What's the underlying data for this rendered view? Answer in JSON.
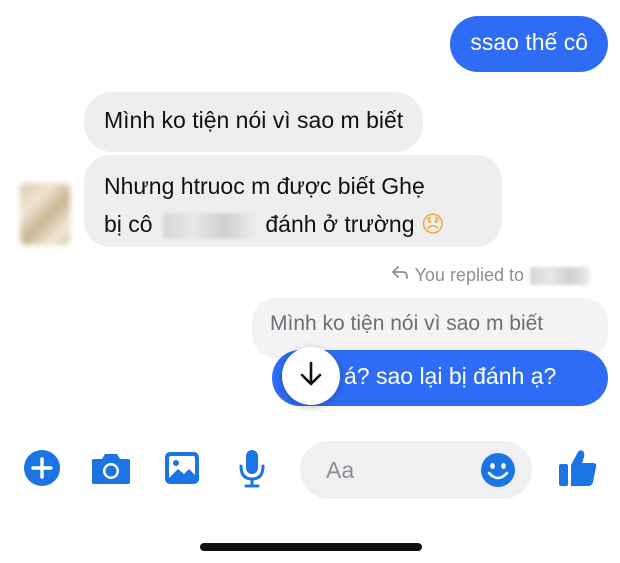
{
  "messages": {
    "sent_1": "ssao thế cô",
    "received_1": "Mình ko tiện nói vì sao m biết",
    "received_2_line1": "Nhưng htruoc m được biết Ghẹ",
    "received_2_line2_prefix": "bị cô",
    "received_2_line2_suffix": "đánh ở trường",
    "received_2_emoji": "😞"
  },
  "reply": {
    "meta_label": "You replied to",
    "quoted_text": "Mình ko tiện nói vì sao m biết",
    "sent_text": "á? sao lại bị đánh ạ?"
  },
  "composer": {
    "placeholder": "Aa"
  },
  "colors": {
    "messenger_blue": "#2f6cf6",
    "incoming_bubble": "#eeeef0",
    "icon_blue": "#1b74e4"
  },
  "icons": [
    "plus-icon",
    "camera-icon",
    "photo-icon",
    "microphone-icon",
    "emoji-icon",
    "thumbs-up-icon",
    "reply-arrow-icon",
    "scroll-down-arrow-icon"
  ]
}
